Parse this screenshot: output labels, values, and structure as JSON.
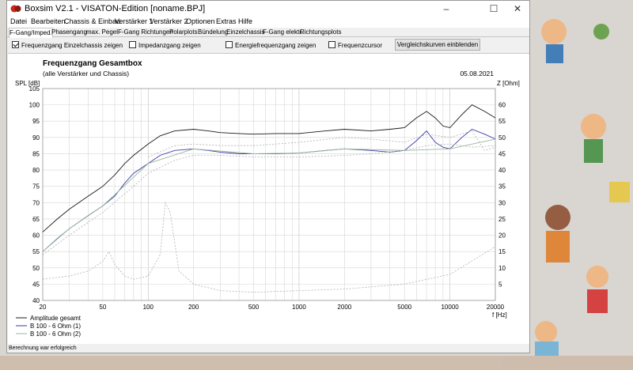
{
  "window": {
    "title": "Boxsim V2.1 - VISATON-Edition [noname.BPJ]",
    "controls": [
      "–",
      "☐",
      "✕"
    ]
  },
  "menu": [
    "Datei",
    "Bearbeiten",
    "Chassis & Einbau",
    "Verstärker 1",
    "Verstärker 2",
    "Optionen",
    "Extras",
    "Hilfe"
  ],
  "tabs": [
    {
      "label": "F-Gang/Imped.",
      "active": true
    },
    {
      "label": "Phasengang",
      "active": false
    },
    {
      "label": "max. Pegel",
      "active": false
    },
    {
      "label": "F-Gang Richtungen",
      "active": false
    },
    {
      "label": "Polarplots",
      "active": false
    },
    {
      "label": "Bündelung",
      "active": false
    },
    {
      "label": "Einzelchassis",
      "active": false
    },
    {
      "label": "F-Gang elektr.",
      "active": false
    },
    {
      "label": "Richtungsplots",
      "active": false
    }
  ],
  "options": [
    {
      "label": "Frequenzgang Einzelchassis zeigen",
      "checked": true
    },
    {
      "label": "Impedanzgang zeigen",
      "checked": false
    },
    {
      "label": "Energiefrequenzgang zeigen",
      "checked": false
    },
    {
      "label": "Frequenzcursor",
      "checked": false
    }
  ],
  "compare_button": "Vergleichskurven einblenden",
  "status": "Berechnung war erfolgreich",
  "chart_data": {
    "type": "line",
    "title": "Frequenzgang Gesamtbox",
    "subtitle": "(alle Verstärker und Chassis)",
    "date": "05.08.2021",
    "xlabel": "f [Hz]",
    "ylabel": "SPL [dB]",
    "y2label": "Z [Ohm]",
    "xscale": "log",
    "xlim": [
      20,
      20000
    ],
    "ylim": [
      40,
      105
    ],
    "y2lim": [
      0,
      65
    ],
    "xticks": [
      20,
      50,
      100,
      200,
      500,
      1000,
      2000,
      5000,
      10000,
      20000
    ],
    "yticks": [
      40,
      45,
      50,
      55,
      60,
      65,
      70,
      75,
      80,
      85,
      90,
      95,
      100,
      105
    ],
    "y2ticks": [
      5,
      10,
      15,
      20,
      25,
      30,
      35,
      40,
      45,
      50,
      55,
      60
    ],
    "grid": true,
    "legend_position": "bottom-left",
    "series": [
      {
        "name": "Amplitude gesamt",
        "color": "#1a1a1a",
        "x": [
          20,
          25,
          30,
          40,
          50,
          60,
          70,
          80,
          100,
          120,
          150,
          200,
          250,
          300,
          400,
          500,
          700,
          1000,
          1500,
          2000,
          3000,
          4000,
          5000,
          6000,
          7000,
          8000,
          9000,
          10000,
          12000,
          14000,
          17000,
          20000
        ],
        "y": [
          61,
          65,
          68,
          72,
          75,
          78.5,
          82,
          84.5,
          88,
          90.5,
          92,
          92.5,
          92,
          91.5,
          91.2,
          91,
          91.2,
          91.2,
          92,
          92.5,
          92,
          92.5,
          93,
          96,
          98,
          96,
          93.5,
          93,
          97,
          100,
          98,
          96
        ]
      },
      {
        "name": "B 100 - 6 Ohm (1)",
        "color": "#3a3aa8",
        "x": [
          20,
          25,
          30,
          40,
          50,
          60,
          70,
          80,
          100,
          120,
          150,
          200,
          250,
          300,
          400,
          500,
          700,
          1000,
          1500,
          2000,
          3000,
          4000,
          5000,
          6000,
          7000,
          8000,
          9000,
          10000,
          12000,
          14000,
          17000,
          20000
        ],
        "y": [
          55,
          59,
          62,
          66,
          69,
          72,
          76,
          79,
          82,
          84.5,
          86,
          86.5,
          86,
          85.5,
          85,
          85,
          85,
          85.2,
          86,
          86.5,
          86,
          85.5,
          86,
          89,
          92,
          88.5,
          87,
          86.5,
          90,
          92.5,
          91,
          89.5
        ]
      },
      {
        "name": "B 100 - 6 Ohm (2)",
        "color": "#9ab89a",
        "x": [
          20,
          30,
          50,
          100,
          200,
          500,
          1000,
          2000,
          5000,
          10000,
          20000
        ],
        "y": [
          55,
          62,
          69,
          82,
          86.5,
          85,
          85.2,
          86.5,
          86,
          86.5,
          89.5
        ]
      },
      {
        "name": "",
        "color": "#b0b0b0",
        "dashed": true,
        "axis": "y2",
        "x": [
          20,
          30,
          40,
          50,
          55,
          60,
          70,
          80,
          100,
          120,
          130,
          140,
          160,
          200,
          300,
          500,
          1000,
          2000,
          5000,
          10000,
          20000
        ],
        "y": [
          6.5,
          7.5,
          9,
          12,
          15,
          11,
          7.5,
          6.5,
          7.5,
          14,
          30,
          27,
          9,
          5,
          3,
          2.5,
          3,
          3.5,
          5,
          8,
          16.5
        ]
      },
      {
        "name": "",
        "color": "#b0b0b0",
        "dashed": true,
        "x": [
          20,
          30,
          50,
          80,
          100,
          150,
          200,
          300,
          500,
          1000,
          2000,
          3000,
          5000,
          7000,
          10000,
          14000,
          20000
        ],
        "y": [
          54,
          60,
          67,
          75,
          79,
          83,
          84.5,
          84.5,
          84,
          84,
          84.5,
          85,
          86,
          87.5,
          88,
          87,
          87.5
        ]
      },
      {
        "name": "",
        "color": "#b0b0b0",
        "dashed": true,
        "x": [
          100,
          150,
          200,
          300,
          500,
          1000,
          2000,
          3000,
          5000,
          7000,
          10000,
          14000,
          17000,
          20000
        ],
        "y": [
          84,
          87.5,
          88,
          87.5,
          87.5,
          88.5,
          90,
          89.5,
          88.5,
          91,
          90,
          92,
          86,
          87
        ]
      }
    ]
  }
}
